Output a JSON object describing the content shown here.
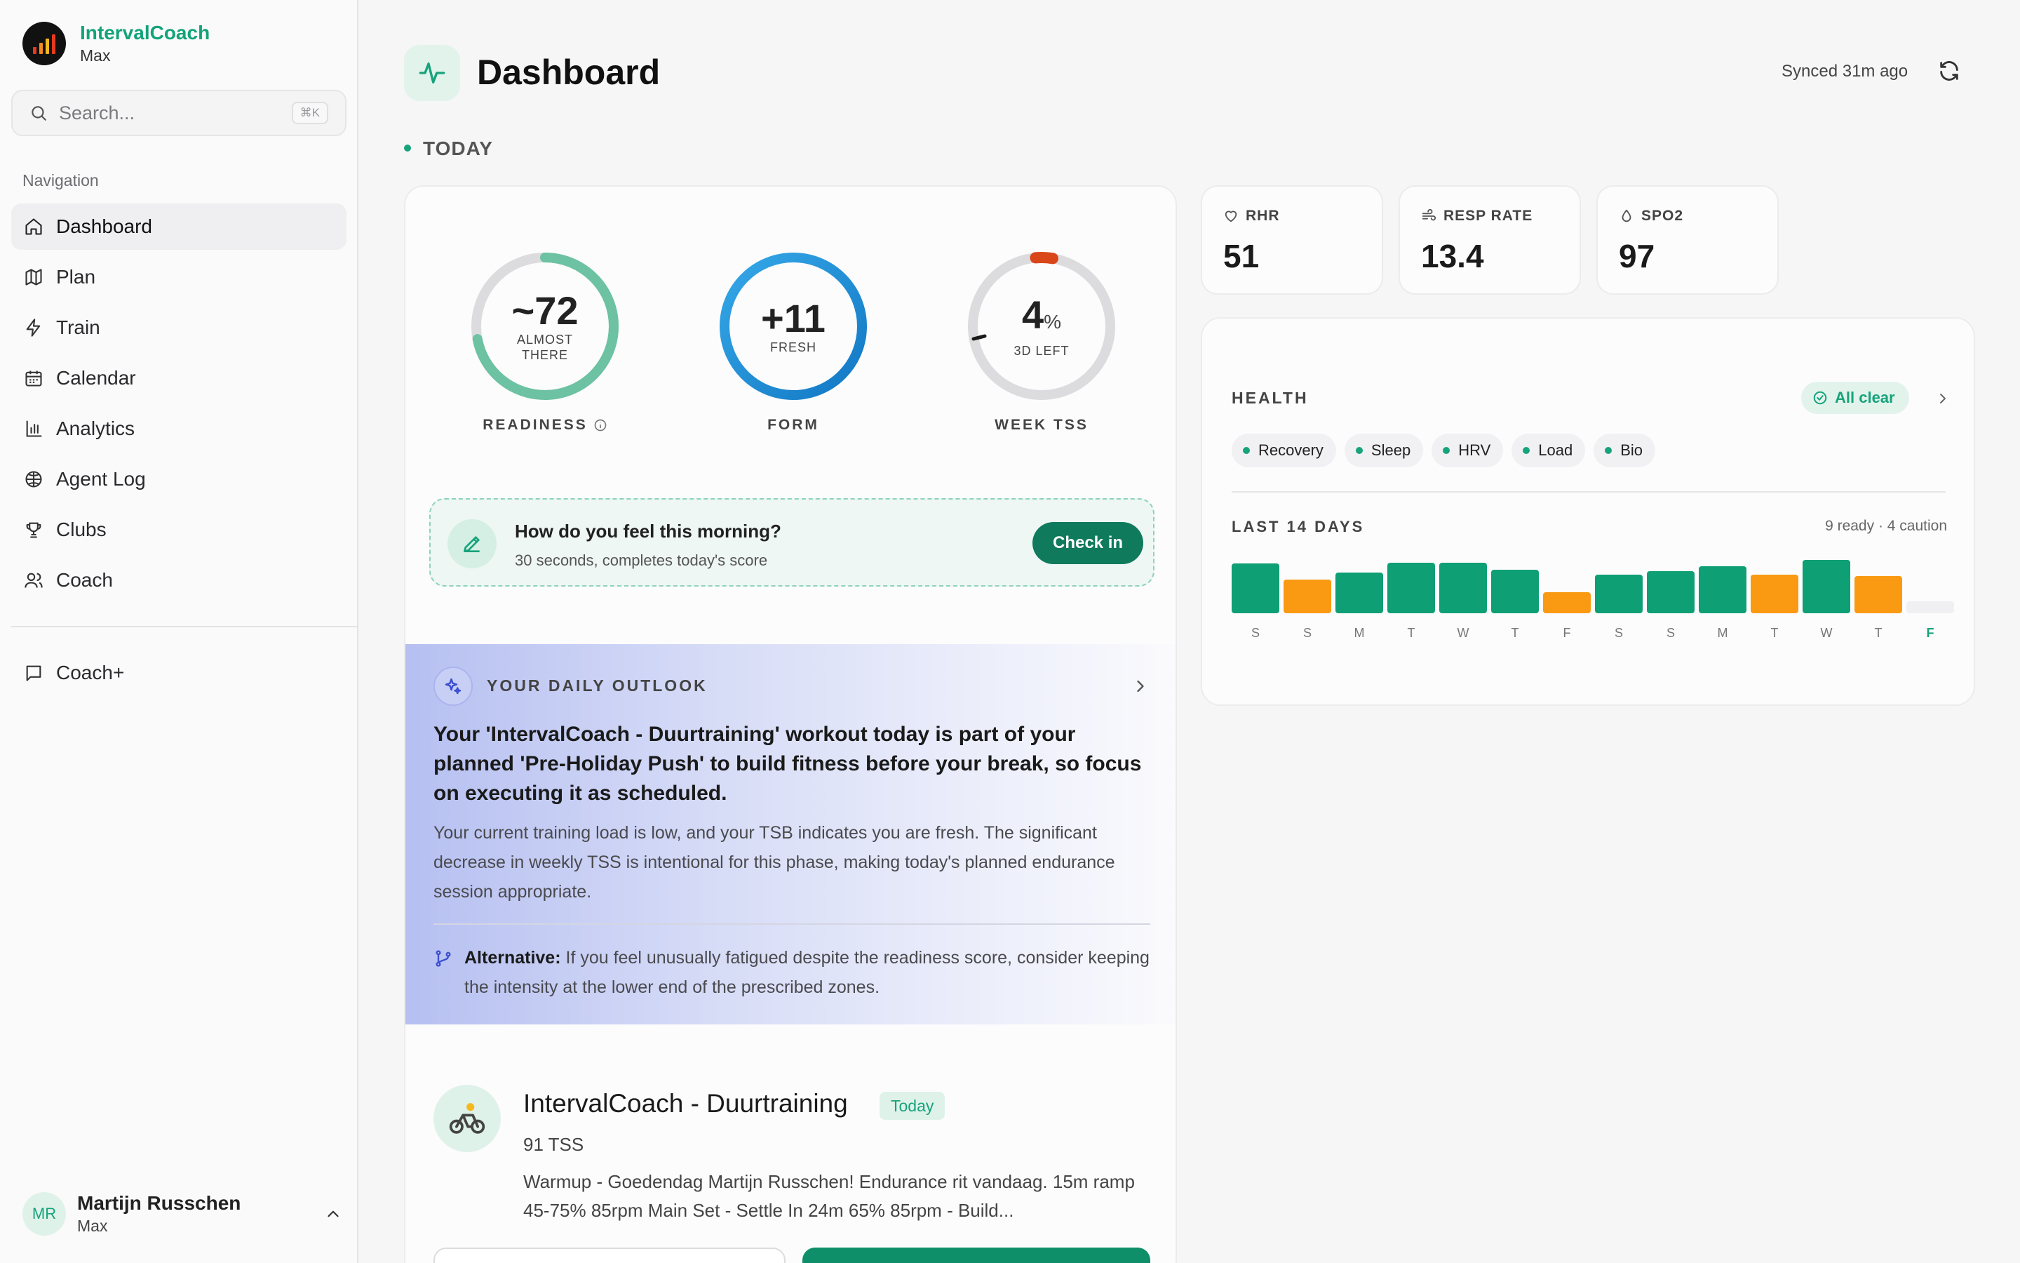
{
  "brand": {
    "name": "IntervalCoach",
    "sub": "Max",
    "logo_colors": [
      "#e63a1e",
      "#f58a1f",
      "#f5b81f",
      "#e63a1e"
    ]
  },
  "search": {
    "placeholder": "Search...",
    "shortcut": "⌘K"
  },
  "nav": {
    "heading": "Navigation",
    "items": [
      {
        "label": "Dashboard",
        "icon": "home-icon",
        "active": true
      },
      {
        "label": "Plan",
        "icon": "map-icon"
      },
      {
        "label": "Train",
        "icon": "lightning-icon"
      },
      {
        "label": "Calendar",
        "icon": "calendar-icon"
      },
      {
        "label": "Analytics",
        "icon": "bar-chart-icon"
      },
      {
        "label": "Agent Log",
        "icon": "brain-icon"
      },
      {
        "label": "Clubs",
        "icon": "trophy-icon"
      },
      {
        "label": "Coach",
        "icon": "users-icon"
      }
    ],
    "extra": [
      {
        "label": "Coach+",
        "icon": "chat-icon"
      }
    ]
  },
  "user": {
    "initials": "MR",
    "name": "Martijn Russchen",
    "sub": "Max"
  },
  "header": {
    "title": "Dashboard",
    "synced": "Synced 31m ago",
    "section": "TODAY"
  },
  "rings": {
    "readiness": {
      "value": "~72",
      "sub": "ALMOST THERE",
      "label": "READINESS",
      "level": 0.72,
      "color": "#6cc2a2"
    },
    "form": {
      "value": "+11",
      "sub": "FRESH",
      "label": "FORM",
      "color": "#1a8ad6"
    },
    "week_tss": {
      "value": "4",
      "unit": "%",
      "sub": "3D LEFT",
      "label": "WEEK TSS",
      "level": 0.04,
      "color": "#d8461a"
    }
  },
  "checkin": {
    "title": "How do you feel this morning?",
    "sub": "30 seconds, completes today's score",
    "button": "Check in"
  },
  "outlook": {
    "label": "YOUR DAILY OUTLOOK",
    "headline": "Your 'IntervalCoach - Duurtraining' workout today is part of your planned 'Pre-Holiday Push' to build fitness before your break, so focus on executing it as scheduled.",
    "body": "Your current training load is low, and your TSB indicates you are fresh. The significant decrease in weekly TSS is intentional for this phase, making today's planned endurance session appropriate.",
    "alt_label": "Alternative:",
    "alt_text": " If you feel unusually fatigued despite the readiness score, consider keeping the intensity at the lower end of the prescribed zones."
  },
  "workout": {
    "title": "IntervalCoach - Duurtraining",
    "badge": "Today",
    "tss": "91 TSS",
    "desc": "Warmup - Goedendag Martijn Russchen! Endurance rit vandaag. 15m ramp 45-75% 85rpm Main Set - Settle In 24m 65% 85rpm - Build..."
  },
  "metrics": [
    {
      "label": "RHR",
      "value": "51",
      "icon": "heart-icon"
    },
    {
      "label": "RESP RATE",
      "value": "13.4",
      "icon": "wind-icon"
    },
    {
      "label": "SPO2",
      "value": "97",
      "icon": "drop-icon"
    }
  ],
  "health": {
    "title": "HEALTH",
    "status": "All clear",
    "chips": [
      "Recovery",
      "Sleep",
      "HRV",
      "Load",
      "Bio"
    ],
    "days_title": "LAST 14 DAYS",
    "days_summary": "9 ready · 4 caution",
    "colors": {
      "ready": "#0f9f74",
      "caution": "#f99a12",
      "empty": "#f0f0f2"
    },
    "days": [
      {
        "label": "S",
        "status": "ready",
        "level": 0.93
      },
      {
        "label": "S",
        "status": "caution",
        "level": 0.63
      },
      {
        "label": "M",
        "status": "ready",
        "level": 0.76
      },
      {
        "label": "T",
        "status": "ready",
        "level": 0.95
      },
      {
        "label": "W",
        "status": "ready",
        "level": 0.95
      },
      {
        "label": "T",
        "status": "ready",
        "level": 0.81
      },
      {
        "label": "F",
        "status": "caution",
        "level": 0.4
      },
      {
        "label": "S",
        "status": "ready",
        "level": 0.73
      },
      {
        "label": "S",
        "status": "ready",
        "level": 0.79
      },
      {
        "label": "M",
        "status": "ready",
        "level": 0.88
      },
      {
        "label": "T",
        "status": "caution",
        "level": 0.73
      },
      {
        "label": "W",
        "status": "ready",
        "level": 1.0
      },
      {
        "label": "T",
        "status": "caution",
        "level": 0.7
      },
      {
        "label": "F",
        "status": "empty",
        "level": 0.22,
        "today": true
      }
    ]
  }
}
